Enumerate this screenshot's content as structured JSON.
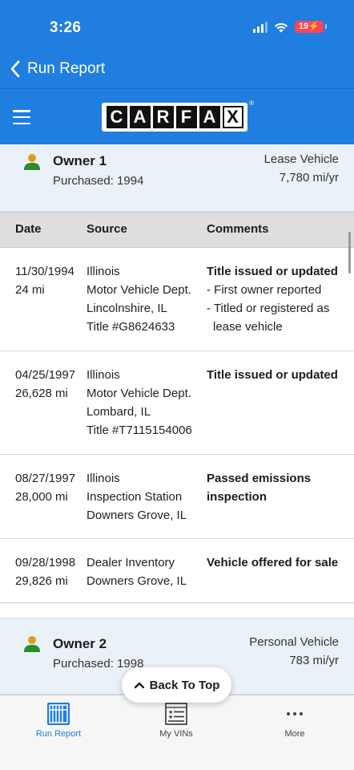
{
  "status": {
    "time": "3:26",
    "battery": "19"
  },
  "nav": {
    "back_label": "Run Report"
  },
  "brand": {
    "logo_letters": [
      "C",
      "A",
      "R",
      "F",
      "A",
      "X"
    ]
  },
  "owners": [
    {
      "title": "Owner 1",
      "purchased": "Purchased: 1994",
      "type": "Lease Vehicle",
      "usage": "7,780 mi/yr"
    },
    {
      "title": "Owner 2",
      "purchased": "Purchased: 1998",
      "type": "Personal Vehicle",
      "usage": "783 mi/yr"
    }
  ],
  "table": {
    "headers": {
      "date": "Date",
      "source": "Source",
      "comments": "Comments"
    },
    "rows": [
      {
        "date": [
          "11/30/1994",
          "24 mi"
        ],
        "source": [
          "Illinois",
          "Motor Vehicle Dept.",
          "Lincolnshire, IL",
          "Title #G8624633"
        ],
        "comment_head": "Title issued or updated",
        "comment_items": [
          "- First owner reported",
          "- Titled or registered as lease vehicle"
        ]
      },
      {
        "date": [
          "04/25/1997",
          "26,628 mi"
        ],
        "source": [
          "Illinois",
          "Motor Vehicle Dept.",
          "Lombard, IL",
          "Title #T7115154006"
        ],
        "comment_head": "Title issued or updated",
        "comment_items": []
      },
      {
        "date": [
          "08/27/1997",
          "28,000 mi"
        ],
        "source": [
          "Illinois",
          "Inspection Station",
          "Downers Grove, IL"
        ],
        "comment_head": "Passed emissions inspection",
        "comment_items": []
      },
      {
        "date": [
          "09/28/1998",
          "29,826 mi"
        ],
        "source": [
          "Dealer Inventory",
          "Downers Grove, IL"
        ],
        "comment_head": "Vehicle offered for sale",
        "comment_items": []
      }
    ]
  },
  "back_to_top": "Back To Top",
  "tabs": [
    {
      "label": "Run Report",
      "icon": "run-report-icon",
      "active": true
    },
    {
      "label": "My VINs",
      "icon": "my-vins-icon",
      "active": false
    },
    {
      "label": "More",
      "icon": "more-dots-icon",
      "active": false
    }
  ],
  "colors": {
    "brand_blue": "#1f7ee0",
    "owner_icon_green": "#2e8b2e",
    "battery_red": "#ff4458"
  }
}
